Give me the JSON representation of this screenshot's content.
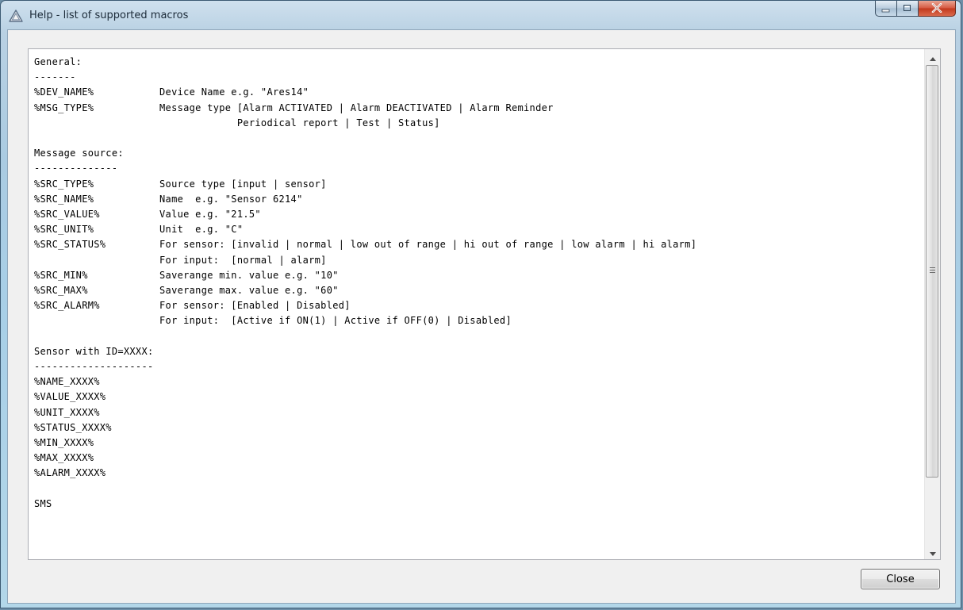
{
  "window": {
    "title": "Help - list of supported macros",
    "icon": "warning-triangle-icon"
  },
  "caption_buttons": {
    "minimize": "minimize-icon",
    "maximize": "maximize-icon",
    "close": "close-x-icon",
    "close_color": "#c2381d"
  },
  "help_text": "General:\n-------\n%DEV_NAME%           Device Name e.g. \"Ares14\"\n%MSG_TYPE%           Message type [Alarm ACTIVATED | Alarm DEACTIVATED | Alarm Reminder\n                                  Periodical report | Test | Status]\n\nMessage source:\n--------------\n%SRC_TYPE%           Source type [input | sensor]\n%SRC_NAME%           Name  e.g. \"Sensor 6214\"\n%SRC_VALUE%          Value e.g. \"21.5\"\n%SRC_UNIT%           Unit  e.g. \"C\"\n%SRC_STATUS%         For sensor: [invalid | normal | low out of range | hi out of range | low alarm | hi alarm]\n                     For input:  [normal | alarm]\n%SRC_MIN%            Saverange min. value e.g. \"10\"\n%SRC_MAX%            Saverange max. value e.g. \"60\"\n%SRC_ALARM%          For sensor: [Enabled | Disabled]\n                     For input:  [Active if ON(1) | Active if OFF(0) | Disabled]\n\nSensor with ID=XXXX:\n--------------------\n%NAME_XXXX%\n%VALUE_XXXX%\n%UNIT_XXXX%\n%STATUS_XXXX%\n%MIN_XXXX%\n%MAX_XXXX%\n%ALARM_XXXX%\n\nSMS",
  "buttons": {
    "close_label": "Close"
  }
}
